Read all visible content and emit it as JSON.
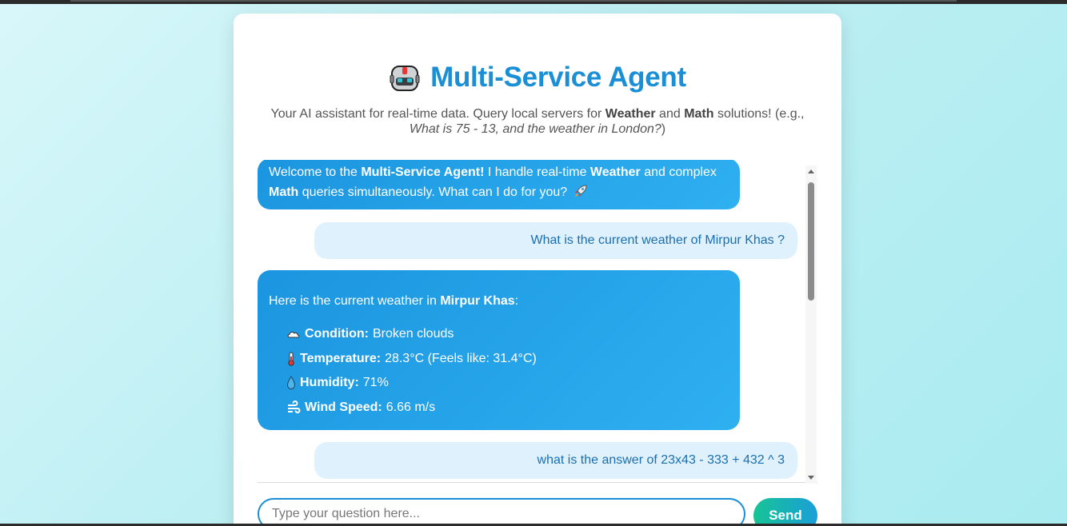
{
  "header": {
    "title": "Multi-Service Agent",
    "subtitle_pre": "Your AI assistant for real-time data. Query local servers for ",
    "subtitle_weather": "Weather",
    "subtitle_and": " and ",
    "subtitle_math": "Math",
    "subtitle_post": " solutions! (e.g.,",
    "subtitle_example": "What is 75 - 13, and the weather in London?",
    "subtitle_close": ")",
    "icon": "robot-icon"
  },
  "chat": {
    "welcome": {
      "pre": "Welcome to the ",
      "name": "Multi-Service Agent!",
      "mid": " I handle real-time ",
      "weather": "Weather",
      "mid2": " and complex",
      "math": "Math",
      "post": " queries simultaneously. What can I do for you?",
      "icon": "rocket-icon"
    },
    "user_1": "What is the current weather of Mirpur Khas ?",
    "weather_reply": {
      "intro_pre": "Here is the current weather in ",
      "city": "Mirpur Khas",
      "intro_post": ":",
      "condition_label": "Condition:",
      "condition_value": "Broken clouds",
      "temperature_label": "Temperature:",
      "temperature_value": "28.3°C (Feels like: 31.4°C)",
      "humidity_label": "Humidity:",
      "humidity_value": "71%",
      "wind_label": "Wind Speed:",
      "wind_value": "6.66 m/s"
    },
    "user_2": "what is the answer of 23x43 - 333 + 432 ^ 3"
  },
  "input": {
    "placeholder": "Type your question here...",
    "value": ""
  },
  "send_label": "Send",
  "colors": {
    "accent": "#1a8fd6",
    "bot_bubble": "#1b95df",
    "user_bubble": "#dff1fc",
    "user_text": "#1a6fb0"
  }
}
